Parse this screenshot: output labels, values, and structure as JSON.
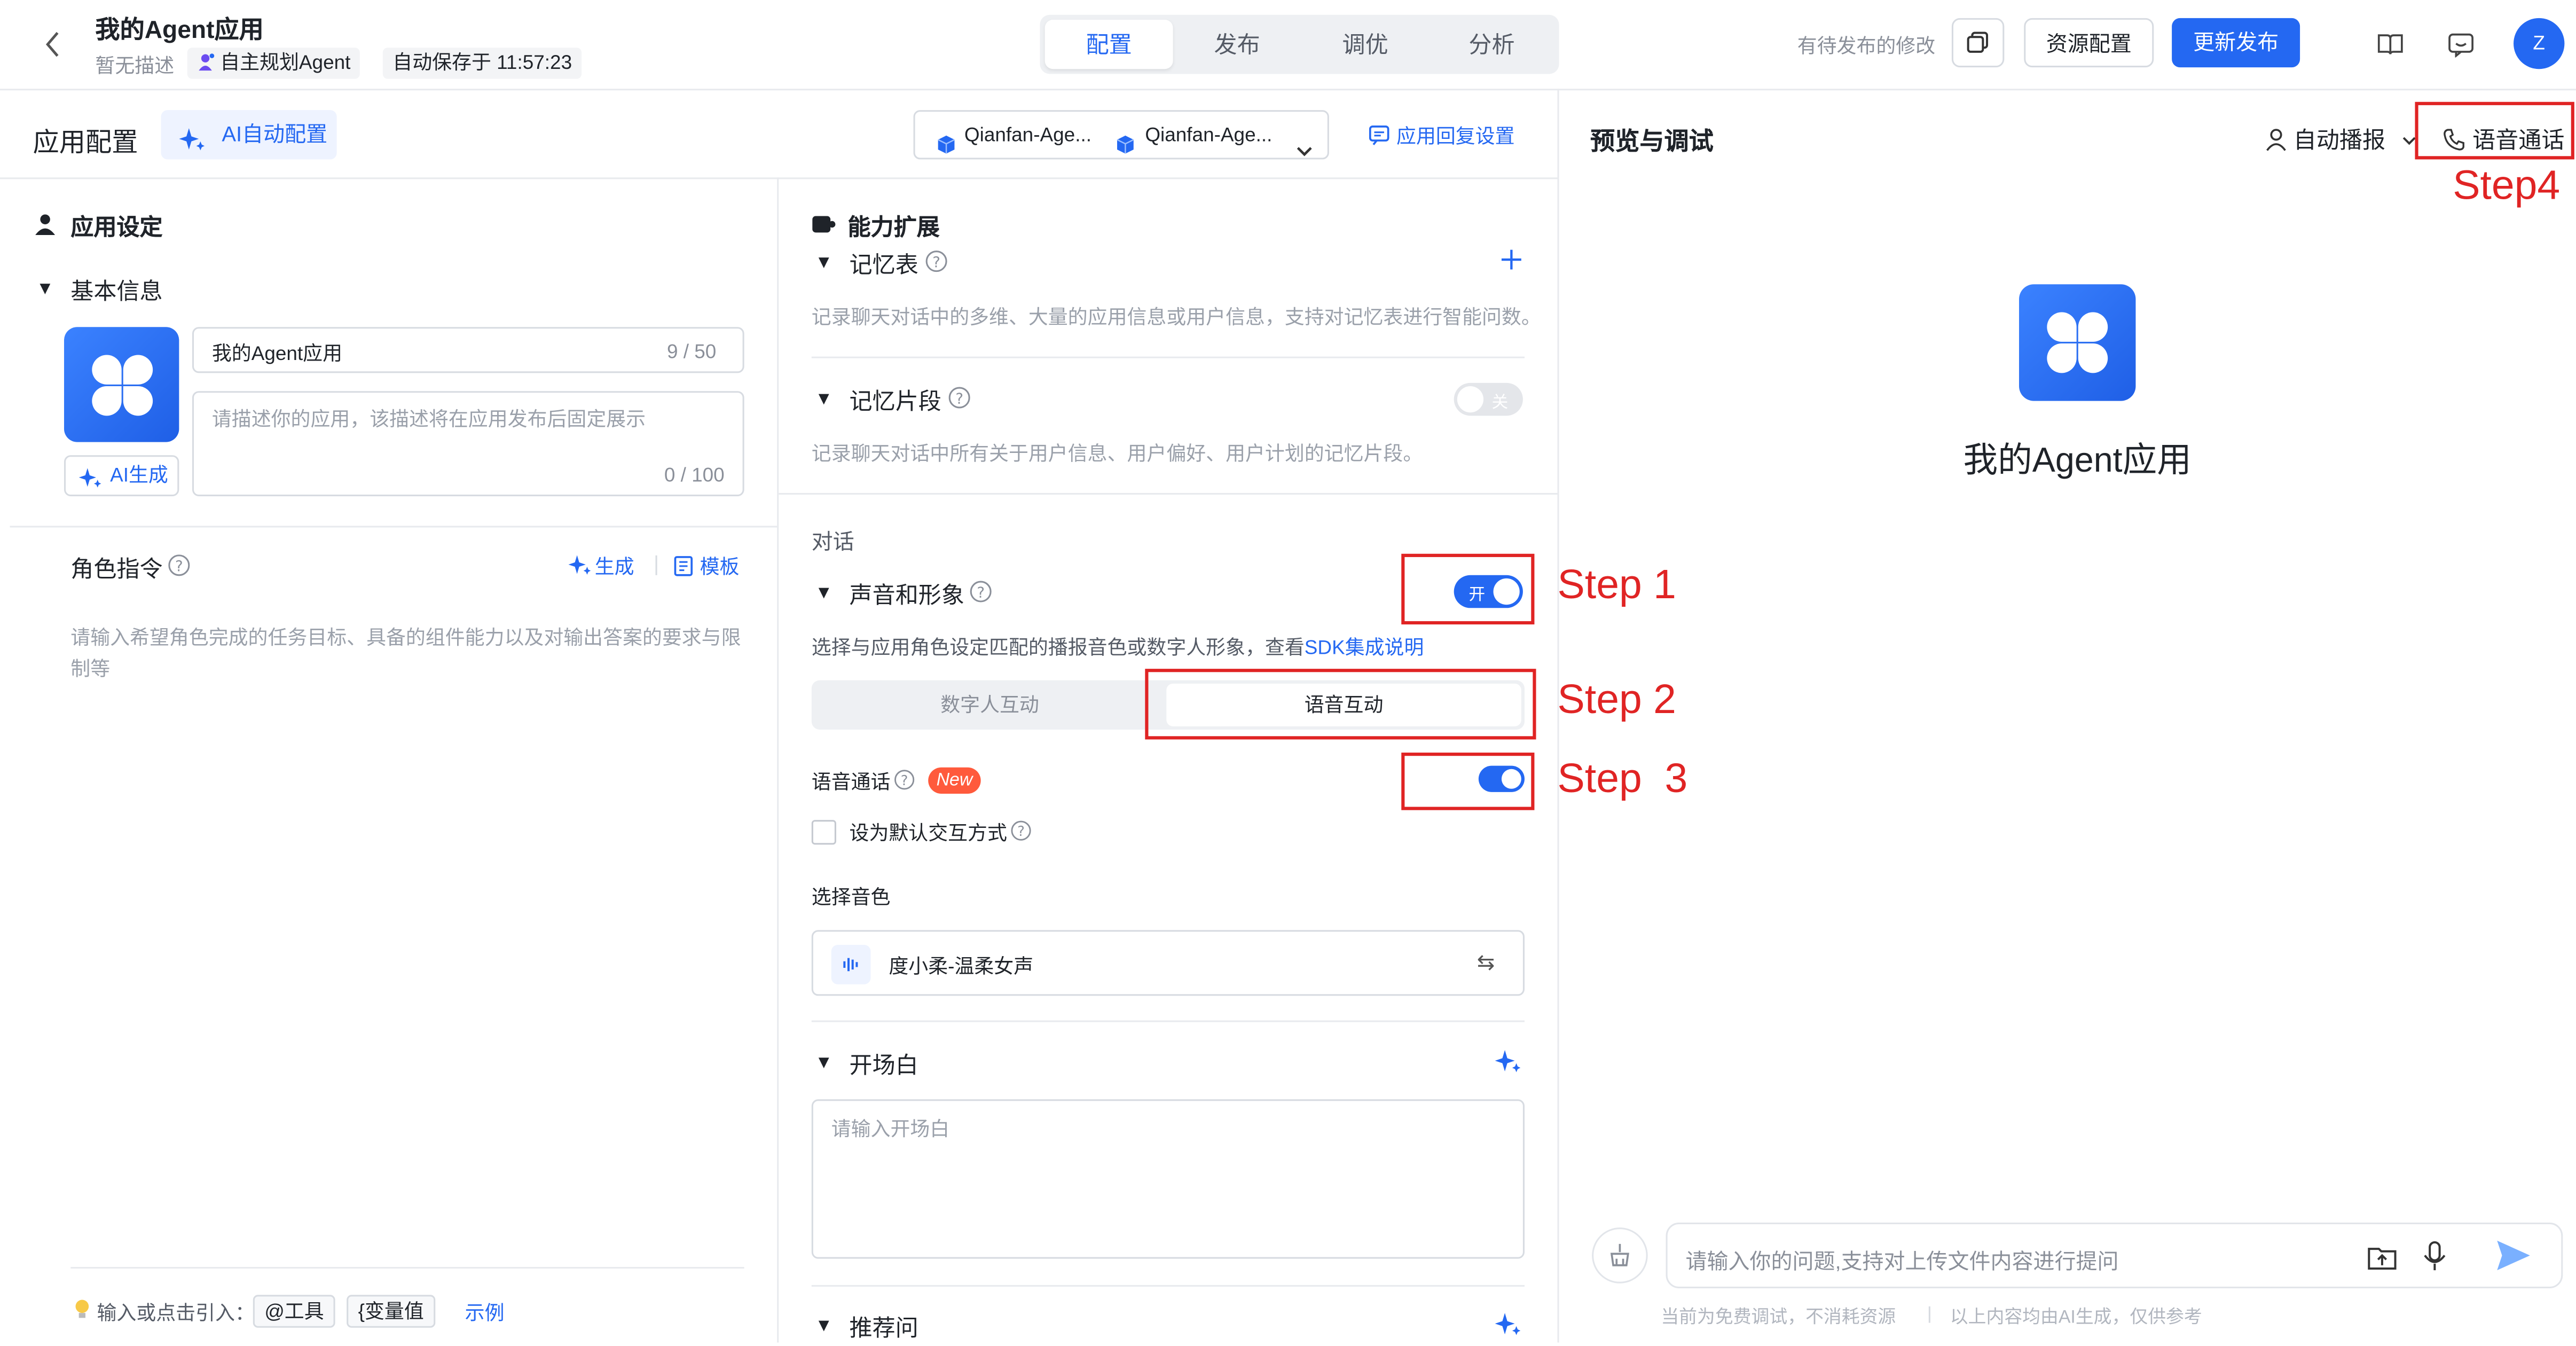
{
  "header": {
    "back_icon": "chevron-left-icon",
    "app_title": "我的Agent应用",
    "description": "暂无描述",
    "agent_type": "自主规划Agent",
    "autosave": "自动保存于 11:57:23",
    "tabs": [
      {
        "label": "配置",
        "active": true
      },
      {
        "label": "发布",
        "active": false
      },
      {
        "label": "调优",
        "active": false
      },
      {
        "label": "分析",
        "active": false
      }
    ],
    "pending_text": "有待发布的修改",
    "resource_button": "资源配置",
    "publish_button": "更新发布",
    "avatar_letter": "Z",
    "accent": "#2468f2"
  },
  "config_bar": {
    "title": "应用配置",
    "ai_button": "AI自动配置",
    "model_1": "Qianfan-Age...",
    "model_2": "Qianfan-Age...",
    "reply_settings": "应用回复设置"
  },
  "app_settings": {
    "title": "应用设定",
    "basic_info": "基本信息",
    "name_value": "我的Agent应用",
    "name_count": "9 / 50",
    "desc_placeholder": "请描述你的应用，该描述将在应用发布后固定展示",
    "desc_count": "0 / 100",
    "ai_generate": "AI生成",
    "role_title": "角色指令",
    "generate": "生成",
    "template": "模板",
    "role_placeholder": "请输入希望角色完成的任务目标、具备的组件能力以及对输出答案的要求与限制等",
    "hint_label": "输入或点击引入：",
    "tag_tool": "@工具",
    "tag_var": "{变量值",
    "example": "示例"
  },
  "capability": {
    "title": "能力扩展",
    "memory_table": "记忆表",
    "memory_table_desc": "记录聊天对话中的多维、大量的应用信息或用户信息，支持对记忆表进行智能问数。",
    "memory_fragment": "记忆片段",
    "memory_fragment_desc": "记录聊天对话中所有关于用户信息、用户偏好、用户计划的记忆片段。",
    "fragment_toggle": "关",
    "dialog_label": "对话",
    "voice_avatar": "声音和形象",
    "voice_toggle": "开",
    "voice_desc": "选择与应用角色设定匹配的播报音色或数字人形象，查看",
    "sdk_link": "SDK集成说明",
    "mode_digital": "数字人互动",
    "mode_voice": "语音互动",
    "voice_call": "语音通话",
    "new_badge": "New",
    "default_interaction": "设为默认交互方式",
    "select_voice": "选择音色",
    "voice_name": "度小柔-温柔女声",
    "opening": "开场白",
    "opening_placeholder": "请输入开场白",
    "recommend": "推荐问"
  },
  "preview": {
    "title": "预览与调试",
    "auto_broadcast": "自动播报",
    "voice_call": "语音通话",
    "app_name": "我的Agent应用",
    "input_placeholder": "请输入你的问题,支持对上传文件内容进行提问",
    "footer_left": "当前为免费调试，不消耗资源",
    "footer_right": "以上内容均由AI生成，仅供参考"
  },
  "annotations": {
    "step1": "Step 1",
    "step2": "Step 2",
    "step3": "Step  3",
    "step4": "Step4",
    "color": "#e02424"
  }
}
